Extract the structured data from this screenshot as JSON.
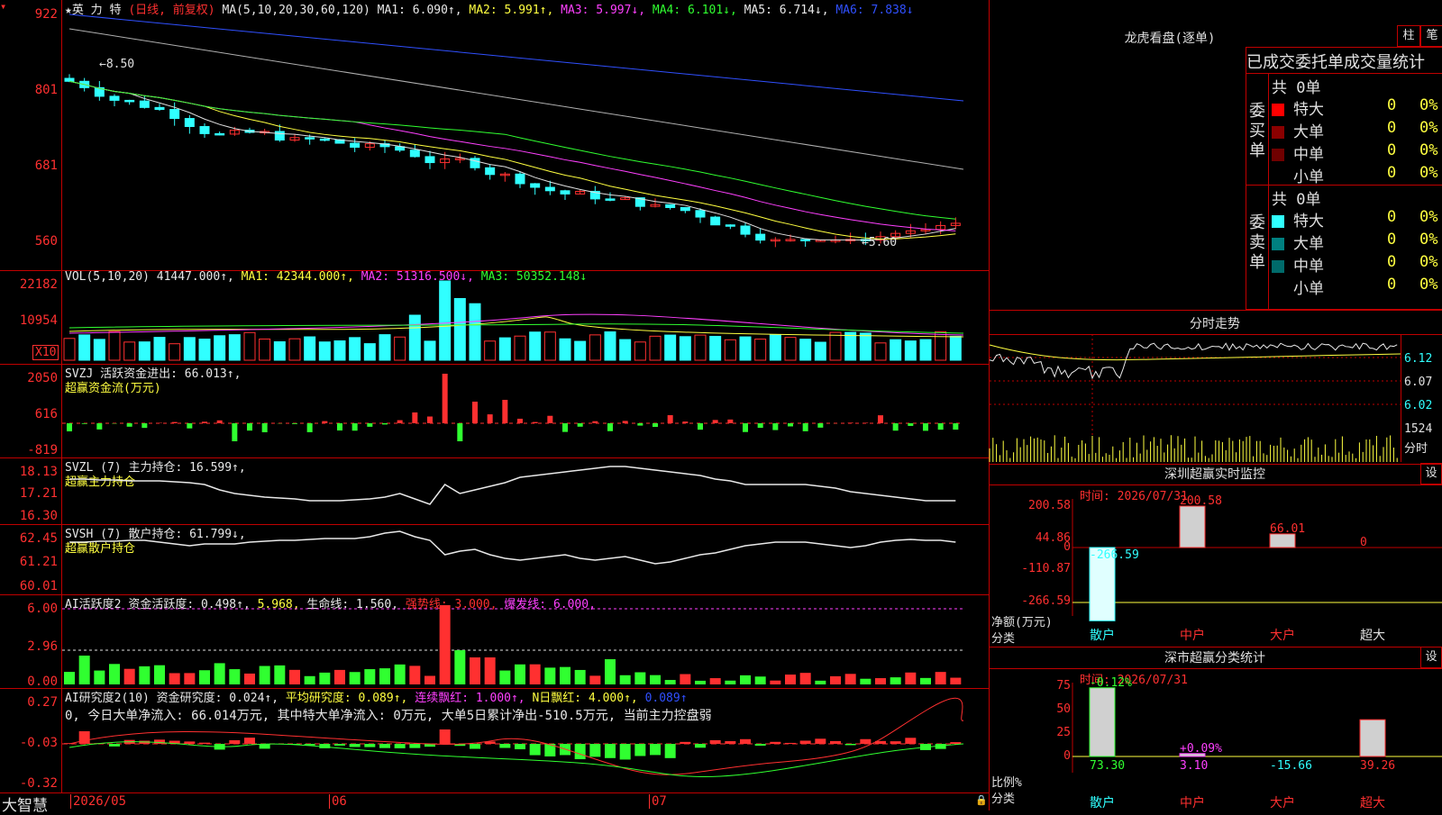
{
  "stock": {
    "name": "★英 力 特",
    "period": "(日线, 前复权)",
    "ma_label": "MA(5,10,20,30,60,120)",
    "ma1": "MA1: 6.090↑,",
    "ma2": "MA2: 5.991↑,",
    "ma3": "MA3: 5.997↓,",
    "ma4": "MA4: 6.101↓,",
    "ma5": "MA5: 6.714↓,",
    "ma6": "MA6: 7.838↓",
    "high_mark": "8.50",
    "low_mark": "5.60",
    "y_labels": [
      "922",
      "801",
      "681",
      "560"
    ]
  },
  "volume": {
    "label": "VOL(5,10,20)",
    "value": "41447.000↑,",
    "ma1": "MA1: 42344.000↑,",
    "ma2": "MA2: 51316.500↓,",
    "ma3": "MA3: 50352.148↓",
    "y_labels": [
      "22182",
      "10954"
    ],
    "unit": "X10"
  },
  "svzj": {
    "label": "SVZJ  活跃资金进出: 66.013↑,",
    "sub": "超赢资金流(万元)",
    "y_labels": [
      "2050",
      "616",
      "-819"
    ]
  },
  "svzl": {
    "label": "SVZL (7) 主力持仓: 16.599↑,",
    "sub": "超赢主力持仓",
    "y_labels": [
      "18.13",
      "17.21",
      "16.30"
    ]
  },
  "svsh": {
    "label": "SVSH (7) 散户持仓: 61.799↓,",
    "sub": "超赢散户持仓",
    "y_labels": [
      "62.45",
      "61.21",
      "60.01"
    ]
  },
  "ai_active": {
    "label": "AI活跃度2",
    "v1": "资金活跃度: 0.498↑,",
    "v2": "5.968,",
    "v3": "生命线: 1.560,",
    "v4": "强势线: 3.000,",
    "v5": "爆发线: 6.000,",
    "y_labels": [
      "6.00",
      "2.96",
      "0.00"
    ]
  },
  "ai_research": {
    "label": "AI研究度2(10)",
    "v1": "资金研究度: 0.024↑,",
    "v2": "平均研究度: 0.089↑,",
    "v3": "连续飘红: 1.000↑,",
    "v4": "N日飘红: 4.000↑,",
    "v5": "0.089↑",
    "note": "0, 今日大单净流入: 66.014万元, 其中特大单净流入: 0万元, 大单5日累计净出-510.5万元, 当前主力控盘弱",
    "y_labels": [
      "0.27",
      "-0.03",
      "-0.32"
    ]
  },
  "bottom": {
    "brand": "大智慧",
    "dates": [
      "2026/05",
      "06",
      "07"
    ]
  },
  "right": {
    "dragon_title": "龙虎看盘(逐单)",
    "btn1": "柱",
    "btn2": "笔",
    "order_title": "已成交委托单成交量统计",
    "buy_label": "委买单",
    "sell_label": "委卖单",
    "buy_total": "共 0单",
    "sell_total": "共 0单",
    "buy_rows": [
      {
        "name": "特大",
        "count": "0",
        "pct": "0%",
        "color": "#ff0000"
      },
      {
        "name": "大单",
        "count": "0",
        "pct": "0%",
        "color": "#8b0000"
      },
      {
        "name": "中单",
        "count": "0",
        "pct": "0%",
        "color": "#700000"
      },
      {
        "name": "小单",
        "count": "0",
        "pct": "0%",
        "color": "#000000"
      }
    ],
    "sell_rows": [
      {
        "name": "特大",
        "count": "0",
        "pct": "0%",
        "color": "#30ffff"
      },
      {
        "name": "大单",
        "count": "0",
        "pct": "0%",
        "color": "#008080"
      },
      {
        "name": "中单",
        "count": "0",
        "pct": "0%",
        "color": "#006b6b"
      },
      {
        "name": "小单",
        "count": "0",
        "pct": "0%",
        "color": "#000000"
      }
    ],
    "intraday_title": "分时走势",
    "intraday_y": [
      "6.12",
      "6.07",
      "6.02"
    ],
    "intraday_vol": "1524",
    "intraday_vol_unit": "分时",
    "sz_title": "深圳超赢实时监控",
    "sz_set": "设",
    "sz_time": "时间: 2026/07/31",
    "sz_y": [
      "200.58",
      "44.86",
      "0",
      "-110.87",
      "-266.59"
    ],
    "sz_unit": "净额(万元)",
    "sz_cat_label": "分类",
    "sz_bars": [
      {
        "cat": "散户",
        "value": -266.59,
        "label": "-266.59"
      },
      {
        "cat": "中户",
        "value": 200.58,
        "label": "200.58"
      },
      {
        "cat": "大户",
        "value": 66.01,
        "label": "66.01"
      },
      {
        "cat": "超大",
        "value": 0,
        "label": "0"
      }
    ],
    "stat_title": "深市超赢分类统计",
    "stat_set": "设",
    "stat_time": "时间: 2026/07/31",
    "stat_y": [
      "75",
      "50",
      "25",
      "0"
    ],
    "stat_unit": "比例%",
    "stat_cat_label": "分类",
    "stat_bars": [
      {
        "cat": "散户",
        "value": 73.3,
        "label": "73.30",
        "change": "-0.12%"
      },
      {
        "cat": "中户",
        "value": 3.1,
        "label": "3.10",
        "change": "+0.09%"
      },
      {
        "cat": "大户",
        "value": 0,
        "label": "-15.66",
        "change": ""
      },
      {
        "cat": "超大",
        "value": 39.26,
        "label": "39.26",
        "change": ""
      }
    ]
  }
}
